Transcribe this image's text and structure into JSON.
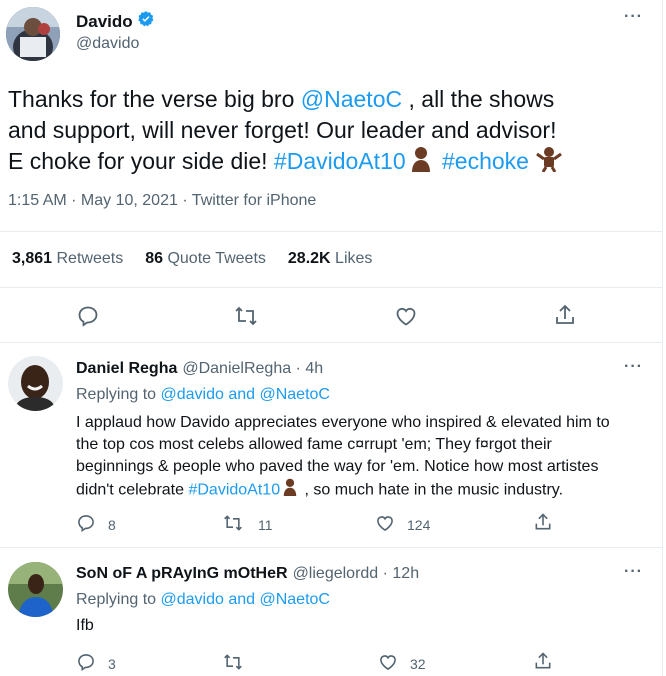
{
  "main_tweet": {
    "display_name": "Davido",
    "handle": "@davido",
    "text": {
      "line1_a": "Thanks for the verse big bro ",
      "mention": "@NaetoC",
      "line1_b": " , all the shows",
      "line2": "and support, will never forget! Our leader and advisor!",
      "line3_a": "E choke for your side die! ",
      "hashtag1": "#DavidoAt10",
      "hashtag2": "#echoke"
    },
    "meta": "1:15 AM · May 10, 2021 · Twitter for iPhone",
    "stats": {
      "retweets_count": "3,861",
      "retweets_label": "Retweets",
      "quote_count": "86",
      "quote_label": "Quote Tweets",
      "likes_count": "28.2K",
      "likes_label": "Likes"
    }
  },
  "replies": [
    {
      "display_name": "Daniel Regha",
      "handle_time": "@DanielRegha · 4h",
      "replying_prefix": "Replying to ",
      "replying_to": "@davido and @NaetoC",
      "lines": [
        "I applaud how Davido appreciates everyone who inspired & elevated him to",
        "the top cos most celebs allowed fame c¤rrupt 'em; They f¤rgot their",
        "beginnings & people who paved the way for 'em. Notice how most artistes"
      ],
      "line4_a": "didn't celebrate ",
      "line4_tag": "#DavidoAt10",
      "line4_b": " , so much hate in the music industry.",
      "reply_count": "8",
      "retweet_count": "11",
      "like_count": "124"
    },
    {
      "display_name": "SoN oF A pRAyInG mOtHeR",
      "handle_time": "@liegelordd · 12h",
      "replying_prefix": "Replying to ",
      "replying_to": "@davido and @NaetoC",
      "text": "Ifb",
      "reply_count": "3",
      "retweet_count": "",
      "like_count": "32"
    }
  ],
  "icons": [
    "verified-badge-icon",
    "more-icon",
    "reply-icon",
    "retweet-icon",
    "like-icon",
    "share-icon",
    "person-emoji-icon",
    "dancing-emoji-icon"
  ],
  "colors": {
    "link": "#1d9bf0",
    "muted": "#536471",
    "text": "#0f1419",
    "divider": "#e6ecf0"
  }
}
